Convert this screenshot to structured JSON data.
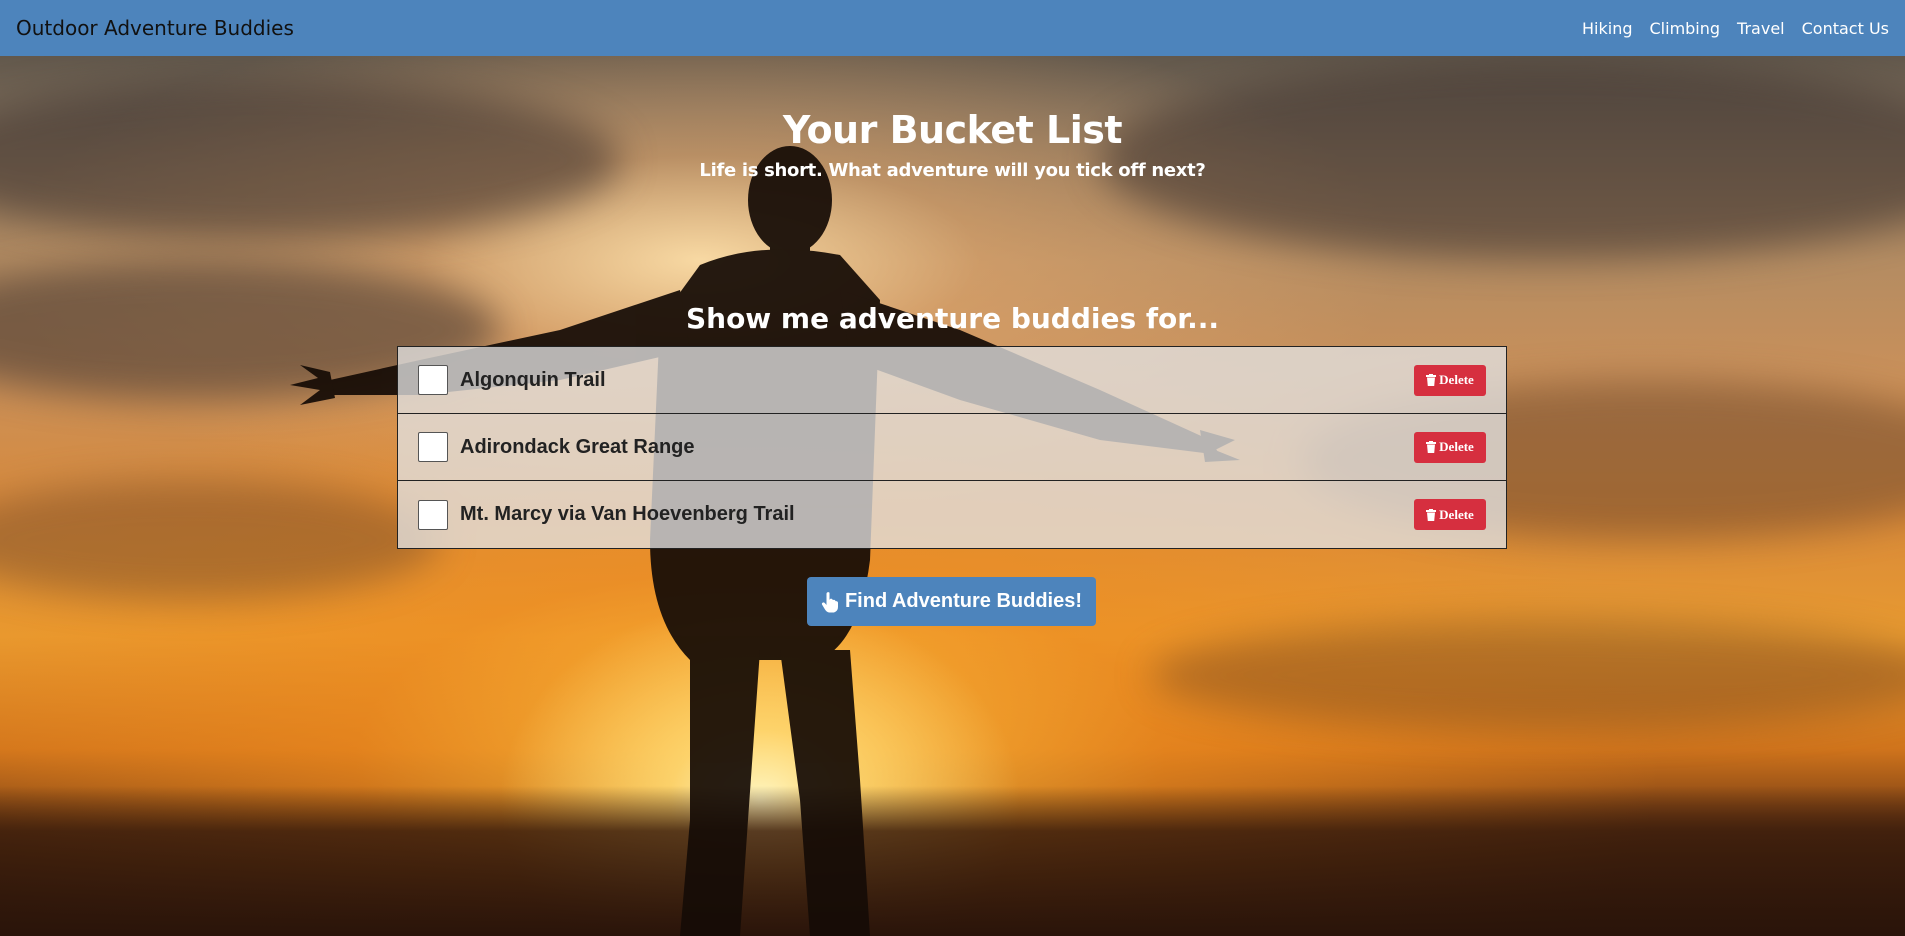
{
  "navbar": {
    "brand": "Outdoor Adventure Buddies",
    "links": [
      {
        "label": "Hiking"
      },
      {
        "label": "Climbing"
      },
      {
        "label": "Travel"
      },
      {
        "label": "Contact Us"
      }
    ],
    "color": "#4d84bc"
  },
  "hero": {
    "title": "Your Bucket List",
    "subtitle": "Life is short. What adventure will you tick off next?"
  },
  "section": {
    "heading": "Show me adventure buddies for..."
  },
  "bucket_list": {
    "items": [
      {
        "label": "Algonquin Trail",
        "checked": false,
        "delete_label": "Delete"
      },
      {
        "label": "Adirondack Great Range",
        "checked": false,
        "delete_label": "Delete"
      },
      {
        "label": "Mt. Marcy via Van Hoevenberg Trail",
        "checked": false,
        "delete_label": "Delete"
      }
    ],
    "delete_color": "#d62f3f",
    "delete_icon": "trash-icon"
  },
  "find_button": {
    "label": "Find Adventure Buddies!",
    "icon": "hand-pointer-icon"
  }
}
